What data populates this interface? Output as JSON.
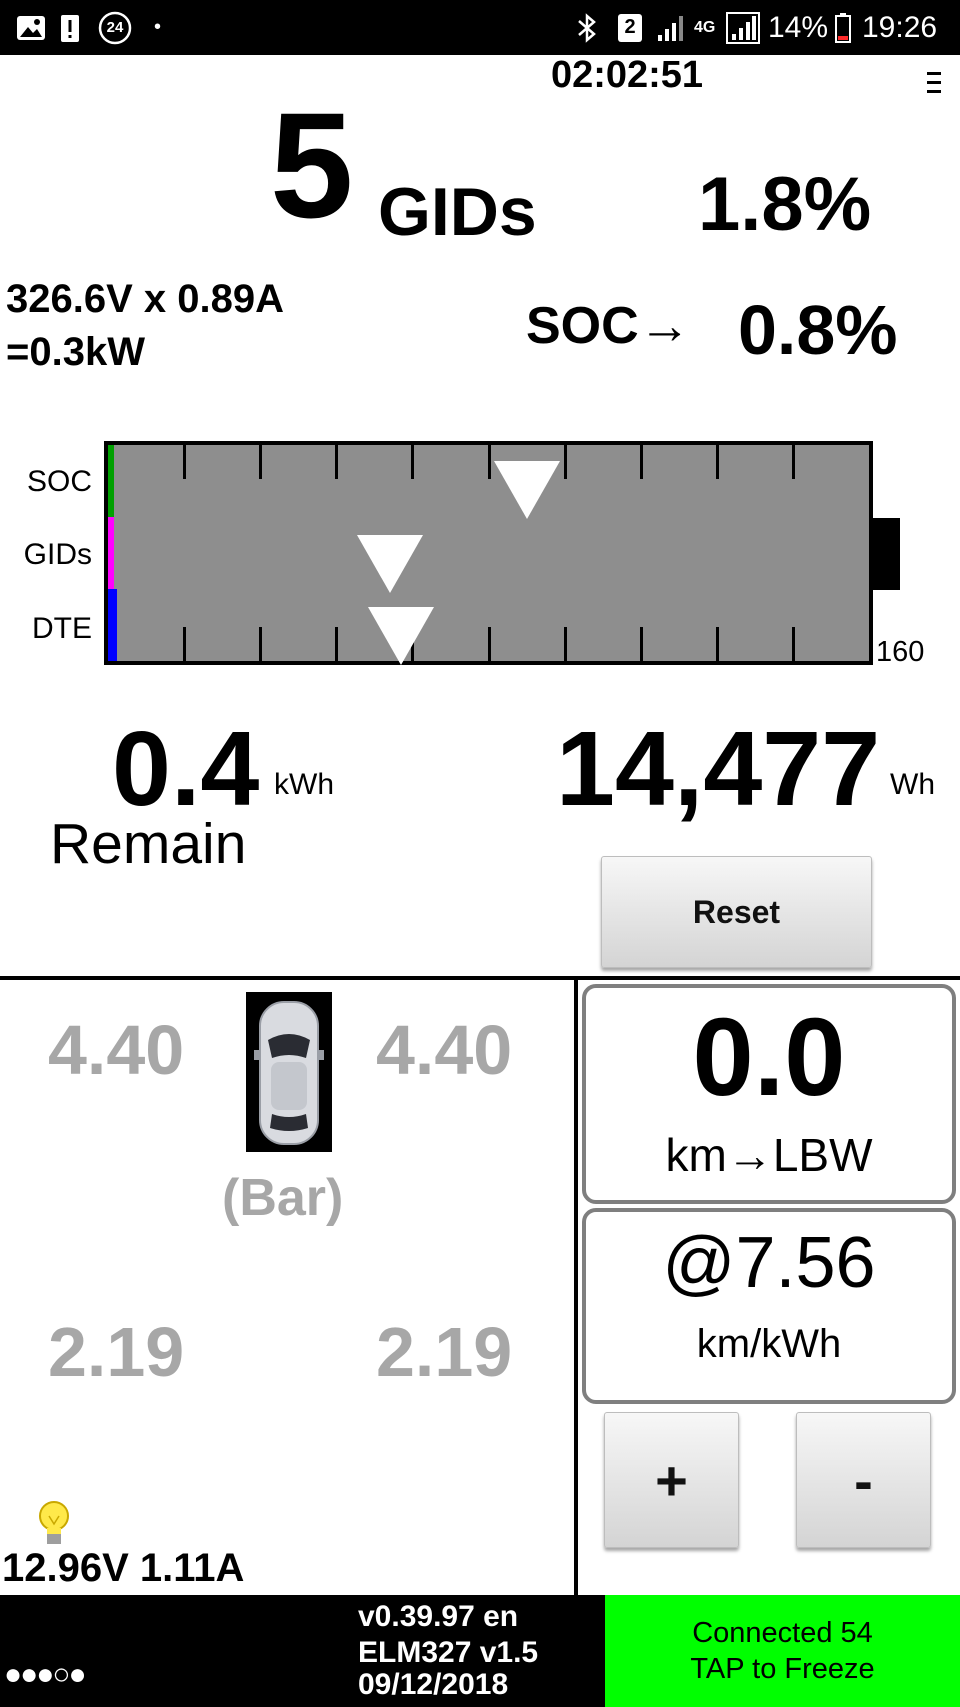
{
  "status_bar": {
    "notification_count": "24",
    "sim_slot": "2",
    "network_type": "4G",
    "battery_percent": "14%",
    "time": "19:26"
  },
  "header": {
    "elapsed_time": "02:02:51",
    "menu_icon": "hamburger-menu-icon"
  },
  "main": {
    "gids_value": "5",
    "gids_unit": "GIDs",
    "gids_percent": "1.8%",
    "voltage_current": "326.6V x 0.89A",
    "power": "=0.3kW",
    "soc_label": "SOC→",
    "soc_value": "0.8%"
  },
  "gauge": {
    "row_labels": [
      "SOC",
      "GIDs",
      "DTE"
    ],
    "max_label": "160",
    "levels": {
      "soc": 0.008,
      "gids": 0.018,
      "dte": 0.04
    },
    "marker_positions": {
      "soc": 0.55,
      "gids": 0.37,
      "dte": 0.385
    },
    "level_colors": {
      "soc": "#00a000",
      "gids": "#ff00ff",
      "dte": "#0000ff"
    },
    "track_color": "#8e8e8e"
  },
  "energy": {
    "remain_value": "0.4",
    "remain_unit": "kWh",
    "remain_label": "Remain",
    "wh_value": "14,477",
    "wh_unit": "Wh",
    "reset_label": "Reset"
  },
  "tires": {
    "front_left": "4.40",
    "front_right": "4.40",
    "unit": "(Bar)",
    "rear_left": "2.19",
    "rear_right": "2.19",
    "car_icon": "car-top-view-icon"
  },
  "aux_battery": {
    "bulb_icon": "light-bulb-icon",
    "reading": "12.96V 1.11A"
  },
  "range": {
    "value": "0.0",
    "label": "km→LBW",
    "efficiency_value": "@7.56",
    "efficiency_unit": "km/kWh",
    "plus_label": "+",
    "minus_label": "-"
  },
  "footer": {
    "dots": "●●●○●",
    "version": "v0.39.97 en",
    "adapter": "ELM327 v1.5",
    "date": "09/12/2018",
    "connection_status": "Connected 54",
    "tap_hint": "TAP to Freeze",
    "connected_color": "#00ff00"
  }
}
